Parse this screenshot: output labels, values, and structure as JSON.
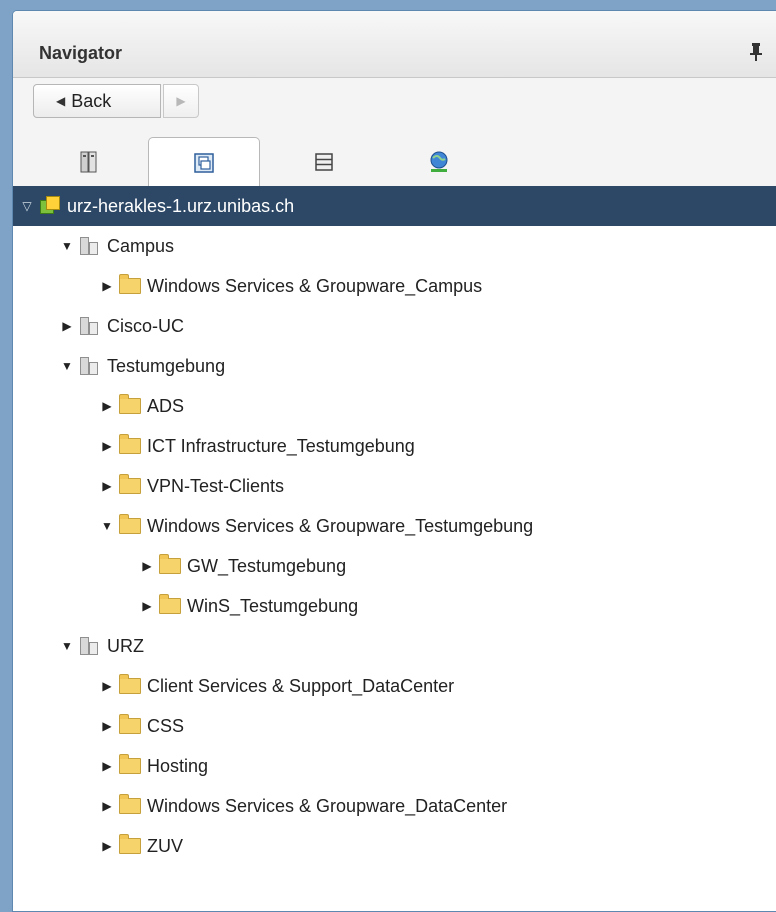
{
  "navigator": {
    "title": "Navigator",
    "pin_icon": "pin-icon",
    "back_label": "Back",
    "tabs": [
      {
        "name": "hosts-clusters",
        "icon": "server-icon",
        "active": false
      },
      {
        "name": "vms-templates",
        "icon": "vm-icon",
        "active": true
      },
      {
        "name": "storage",
        "icon": "storage-icon",
        "active": false
      },
      {
        "name": "networking",
        "icon": "network-globe-icon",
        "active": false
      }
    ]
  },
  "tree": {
    "selected_color": "#2c4866",
    "items": [
      {
        "label": "urz-herakles-1.urz.unibas.ch",
        "type": "vcenter",
        "expanded": true,
        "selected": true
      },
      {
        "label": "Campus",
        "type": "datacenter",
        "expanded": true
      },
      {
        "label": "Windows Services & Groupware_Campus",
        "type": "folder",
        "expanded": false
      },
      {
        "label": "Cisco-UC",
        "type": "datacenter",
        "expanded": false
      },
      {
        "label": "Testumgebung",
        "type": "datacenter",
        "expanded": true
      },
      {
        "label": "ADS",
        "type": "folder",
        "expanded": false
      },
      {
        "label": "ICT Infrastructure_Testumgebung",
        "type": "folder",
        "expanded": false
      },
      {
        "label": "VPN-Test-Clients",
        "type": "folder",
        "expanded": false
      },
      {
        "label": "Windows Services & Groupware_Testumgebung",
        "type": "folder",
        "expanded": true
      },
      {
        "label": "GW_Testumgebung",
        "type": "folder",
        "expanded": false
      },
      {
        "label": "WinS_Testumgebung",
        "type": "folder",
        "expanded": false
      },
      {
        "label": "URZ",
        "type": "datacenter",
        "expanded": true
      },
      {
        "label": "Client Services & Support_DataCenter",
        "type": "folder",
        "expanded": false
      },
      {
        "label": "CSS",
        "type": "folder",
        "expanded": false
      },
      {
        "label": "Hosting",
        "type": "folder",
        "expanded": false
      },
      {
        "label": "Windows Services & Groupware_DataCenter",
        "type": "folder",
        "expanded": false
      },
      {
        "label": "ZUV",
        "type": "folder",
        "expanded": false
      }
    ]
  }
}
